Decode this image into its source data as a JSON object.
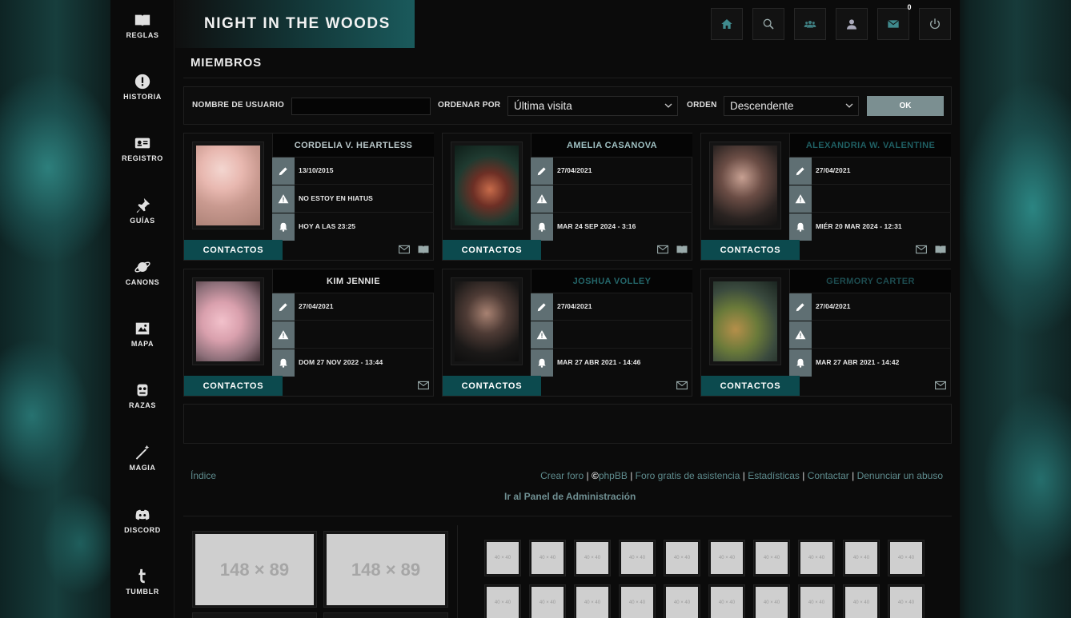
{
  "sidebar": {
    "items": [
      {
        "label": "REGLAS",
        "icon": "book-icon"
      },
      {
        "label": "HISTORIA",
        "icon": "exclamation-icon"
      },
      {
        "label": "REGISTRO",
        "icon": "id-card-icon"
      },
      {
        "label": "GUÍAS",
        "icon": "pin-icon"
      },
      {
        "label": "CANONS",
        "icon": "planet-icon"
      },
      {
        "label": "MAPA",
        "icon": "map-icon"
      },
      {
        "label": "RAZAS",
        "icon": "robot-icon"
      },
      {
        "label": "MAGIA",
        "icon": "wand-icon"
      },
      {
        "label": "DISCORD",
        "icon": "discord-icon"
      },
      {
        "label": "TUMBLR",
        "icon": "tumblr-icon"
      }
    ]
  },
  "header": {
    "logo": "NIGHT IN THE WOODS",
    "buttons": [
      "home-icon",
      "search-icon",
      "group-icon",
      "user-icon",
      "mail-icon",
      "power-icon"
    ],
    "mail_count": "0"
  },
  "page": {
    "title": "MIEMBROS"
  },
  "filter": {
    "username_label": "NOMBRE DE USUARIO",
    "username_value": "",
    "order_by_label": "ORDENAR POR",
    "order_by_value": "Última visita",
    "order_label": "ORDEN",
    "order_value": "Descendente",
    "ok_label": "OK"
  },
  "members": [
    {
      "name": "CORDELIA V. HEARTLESS",
      "name_color": "#b9c7c9",
      "joined": "13/10/2015",
      "status": "NO ESTOY EN HIATUS",
      "last_visit": "HOY A LAS 23:25",
      "contacts": "CONTACTOS",
      "icons": [
        "mail-icon",
        "book-icon"
      ]
    },
    {
      "name": "AMELIA CASANOVA",
      "name_color": "#9fc0c2",
      "joined": "27/04/2021",
      "status": "",
      "last_visit": "MAR 24 SEP 2024 - 3:16",
      "contacts": "CONTACTOS",
      "icons": [
        "mail-icon",
        "book-icon"
      ]
    },
    {
      "name": "ALEXANDRIA W. VALENTINE",
      "name_color": "#1f5f63",
      "joined": "27/04/2021",
      "status": "",
      "last_visit": "MIÉR 20 MAR 2024 - 12:31",
      "contacts": "CONTACTOS",
      "icons": [
        "mail-icon",
        "book-icon"
      ]
    },
    {
      "name": "KIM JENNIE",
      "name_color": "#e6e6e6",
      "joined": "27/04/2021",
      "status": "",
      "last_visit": "DOM 27 NOV 2022 - 13:44",
      "contacts": "CONTACTOS",
      "icons": [
        "mail-icon"
      ]
    },
    {
      "name": "JOSHUA VOLLEY",
      "name_color": "#24666a",
      "joined": "27/04/2021",
      "status": "",
      "last_visit": "MAR 27 ABR 2021 - 14:46",
      "contacts": "CONTACTOS",
      "icons": [
        "mail-icon"
      ]
    },
    {
      "name": "GERMORY CARTER",
      "name_color": "#1d4c50",
      "joined": "27/04/2021",
      "status": "",
      "last_visit": "MAR 27 ABR 2021 - 14:42",
      "contacts": "CONTACTOS",
      "icons": [
        "mail-icon"
      ]
    }
  ],
  "footer": {
    "index": "Índice",
    "links": [
      "Crear foro",
      "©phpBB",
      "Foro gratis de asistencia",
      "Estadísticas",
      "Contactar",
      "Denunciar un abuso"
    ],
    "separator": "|",
    "admin": "Ir al Panel de Administración"
  },
  "affiliates": {
    "big_label": "148 × 89",
    "small_label": "40 × 40"
  }
}
